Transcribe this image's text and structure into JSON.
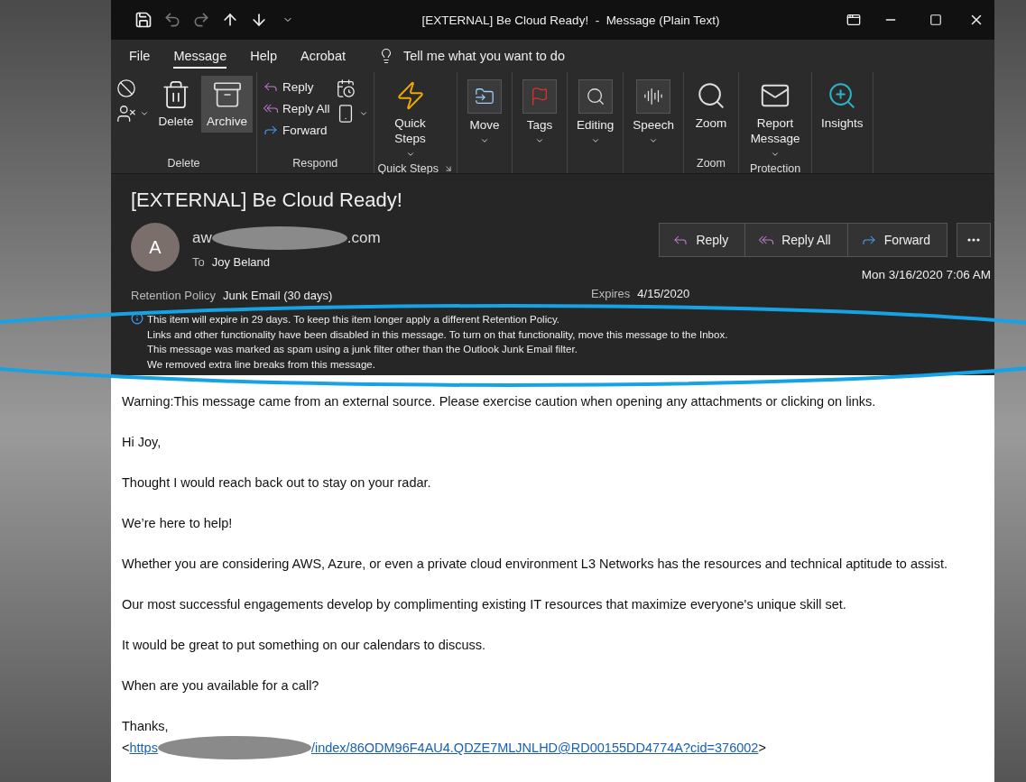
{
  "window": {
    "title": "[EXTERNAL] Be Cloud Ready!  -  Message (Plain Text)"
  },
  "menu_tabs": [
    {
      "label": "File",
      "selected": false
    },
    {
      "label": "Message",
      "selected": true
    },
    {
      "label": "Help",
      "selected": false
    },
    {
      "label": "Acrobat",
      "selected": false
    }
  ],
  "tell_me": {
    "placeholder": "Tell me what you want to do"
  },
  "ribbon_groups": [
    {
      "kind": "delete",
      "label": "Delete",
      "buttons": [
        {
          "label": "Delete",
          "selected": false
        },
        {
          "label": "Archive",
          "selected": true
        }
      ]
    },
    {
      "kind": "respond",
      "label": "Respond",
      "buttons": [
        {
          "label": "Reply"
        },
        {
          "label": "Reply All"
        },
        {
          "label": "Forward"
        }
      ]
    },
    {
      "kind": "large",
      "label": "Quick Steps",
      "launcher": true,
      "buttons": [
        {
          "label": "Quick Steps",
          "dropdown": true
        }
      ]
    },
    {
      "kind": "large",
      "buttons": [
        {
          "label": "Move",
          "dropdown": true
        }
      ]
    },
    {
      "kind": "large",
      "buttons": [
        {
          "label": "Tags",
          "dropdown": true
        }
      ]
    },
    {
      "kind": "large",
      "buttons": [
        {
          "label": "Editing",
          "dropdown": true
        }
      ]
    },
    {
      "kind": "large",
      "buttons": [
        {
          "label": "Speech",
          "dropdown": true
        }
      ]
    },
    {
      "kind": "large",
      "label": "Zoom",
      "buttons": [
        {
          "label": "Zoom",
          "dropdown": false
        }
      ]
    },
    {
      "kind": "large",
      "label": "Protection",
      "buttons": [
        {
          "label": "Report Message",
          "dropdown": true
        }
      ]
    },
    {
      "kind": "large",
      "buttons": [
        {
          "label": "Insights",
          "dropdown": false
        }
      ]
    }
  ],
  "message": {
    "subject": "[EXTERNAL] Be Cloud Ready!",
    "avatar": "A",
    "sender_start": "aw",
    "sender_end": ".com",
    "to_label": "To",
    "to": "Joy Beland",
    "actions": [
      {
        "label": "Reply"
      },
      {
        "label": "Reply All"
      },
      {
        "label": "Forward"
      }
    ],
    "date": "Mon 3/16/2020 7:06 AM",
    "retention_label": "Retention Policy",
    "retention": "Junk Email (30 days)",
    "expires_label": "Expires",
    "expires": "4/15/2020",
    "info_lines": [
      "This item will expire in 29 days. To keep this item longer apply a different Retention Policy.",
      "Links and other functionality have been disabled in this message. To turn on that functionality, move this message to the Inbox.",
      "This message was marked as spam using a junk filter other than the Outlook Junk Email filter.",
      "We removed extra line breaks from this message."
    ]
  },
  "body": {
    "paragraphs": [
      "Warning:This message came from an external source. Please exercise caution when opening any attachments or clicking on links.",
      "Hi Joy,",
      "Thought I would reach back out to stay on your radar.",
      "We’re here to help!",
      "Whether you are considering AWS, Azure, or even a private cloud environment L3 Networks has the resources and technical aptitude to assist.",
      "Our most successful engagements develop by complimenting existing IT resources that maximize everyone's unique skill set.",
      "It would be great to put something on our calendars to discuss.",
      "When are you available for a call?"
    ],
    "closing": "Thanks,",
    "link_open": "<",
    "link_start": "https",
    "link_end": "/index/86ODM96F4AU4.QDZE7MLJNLHD@RD00155DD4774A?cid=376002",
    "link_close": ">"
  }
}
